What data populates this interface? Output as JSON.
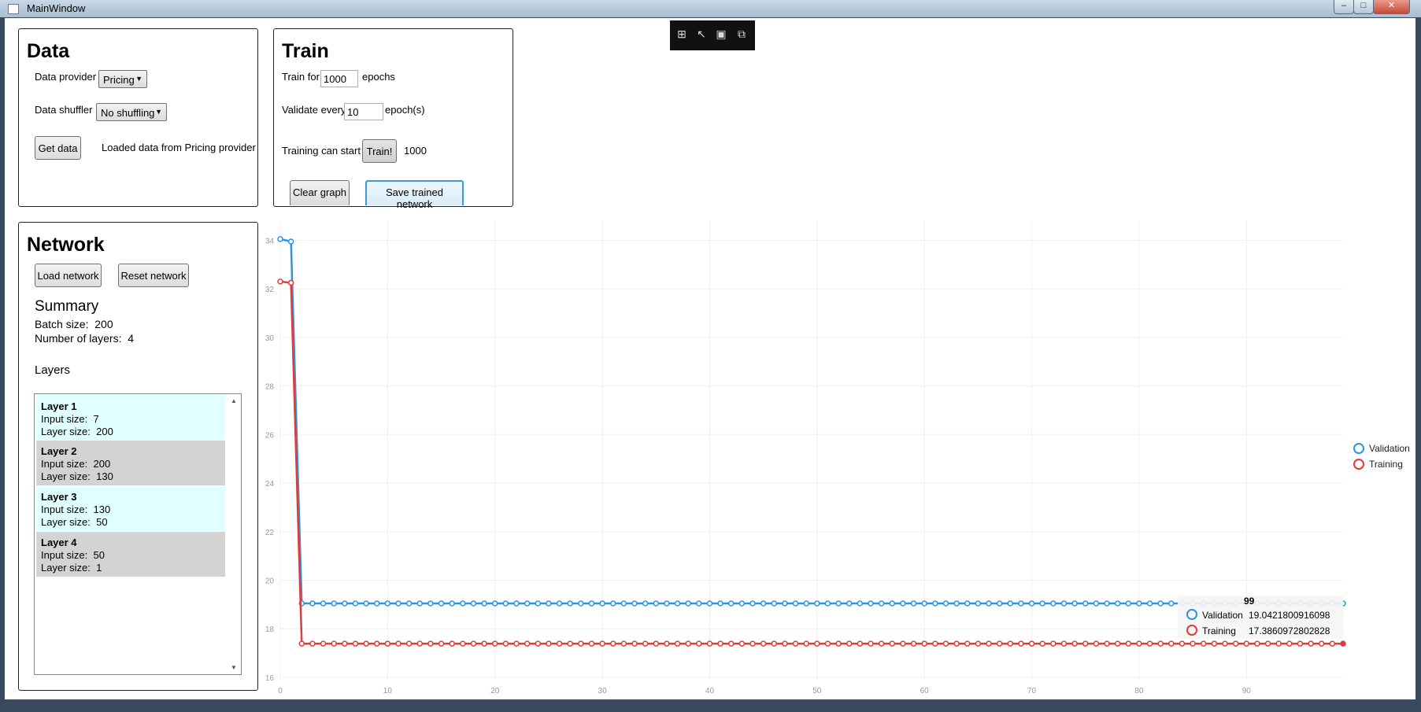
{
  "window": {
    "title": "MainWindow"
  },
  "data_panel": {
    "title": "Data",
    "provider_label": "Data provider",
    "provider_value": "Pricing",
    "shuffler_label": "Data shuffler",
    "shuffler_value": "No shuffling",
    "get_data_label": "Get data",
    "status": "Loaded data from Pricing provider"
  },
  "train_panel": {
    "title": "Train",
    "train_for_label": "Train for",
    "epochs_value": "1000",
    "epochs_label": "epochs",
    "validate_label": "Validate every",
    "validate_value": "10",
    "validate_unit": "epoch(s)",
    "status_label": "Training can start",
    "train_button": "Train!",
    "train_count": "1000",
    "clear_button": "Clear graph",
    "save_button": "Save trained network"
  },
  "network_panel": {
    "title": "Network",
    "load_button": "Load network",
    "reset_button": "Reset network",
    "summary_title": "Summary",
    "batch_label": "Batch size:",
    "batch_value": "200",
    "layers_count_label": "Number of layers:",
    "layers_count_value": "4",
    "layers_title": "Layers",
    "layers": [
      {
        "name": "Layer  1",
        "input_label": "Input size:",
        "input": "7",
        "size_label": "Layer size:",
        "size": "200"
      },
      {
        "name": "Layer  2",
        "input_label": "Input size:",
        "input": "200",
        "size_label": "Layer size:",
        "size": "130"
      },
      {
        "name": "Layer  3",
        "input_label": "Input size:",
        "input": "130",
        "size_label": "Layer size:",
        "size": "50"
      },
      {
        "name": "Layer  4",
        "input_label": "Input size:",
        "input": "50",
        "size_label": "Layer size:",
        "size": "1"
      }
    ]
  },
  "tooltip": {
    "x": "99",
    "validation_label": "Validation",
    "validation_value": "19.0421800916098",
    "training_label": "Training",
    "training_value": "17.3860972802828"
  },
  "colors": {
    "validation": "#2b96e0",
    "training": "#e53935",
    "layer_a": "#e0ffff",
    "layer_b": "#d3d3d3"
  },
  "chart_data": {
    "type": "line",
    "x_ticks": [
      0,
      10,
      20,
      30,
      40,
      50,
      60,
      70,
      80,
      90
    ],
    "y_ticks": [
      16,
      18,
      20,
      22,
      24,
      26,
      28,
      30,
      32,
      34
    ],
    "xlim": [
      0,
      99
    ],
    "ylim": [
      15.9,
      34.5
    ],
    "grid": true,
    "legend_position": "right",
    "series": [
      {
        "name": "Validation",
        "color": "#2b96e0",
        "start": [
          34.05,
          33.95
        ],
        "plateau": 19.0421800916098,
        "n": 100
      },
      {
        "name": "Training",
        "color": "#e53935",
        "start": [
          32.3,
          32.25
        ],
        "plateau": 17.3860972802828,
        "n": 100
      }
    ]
  }
}
